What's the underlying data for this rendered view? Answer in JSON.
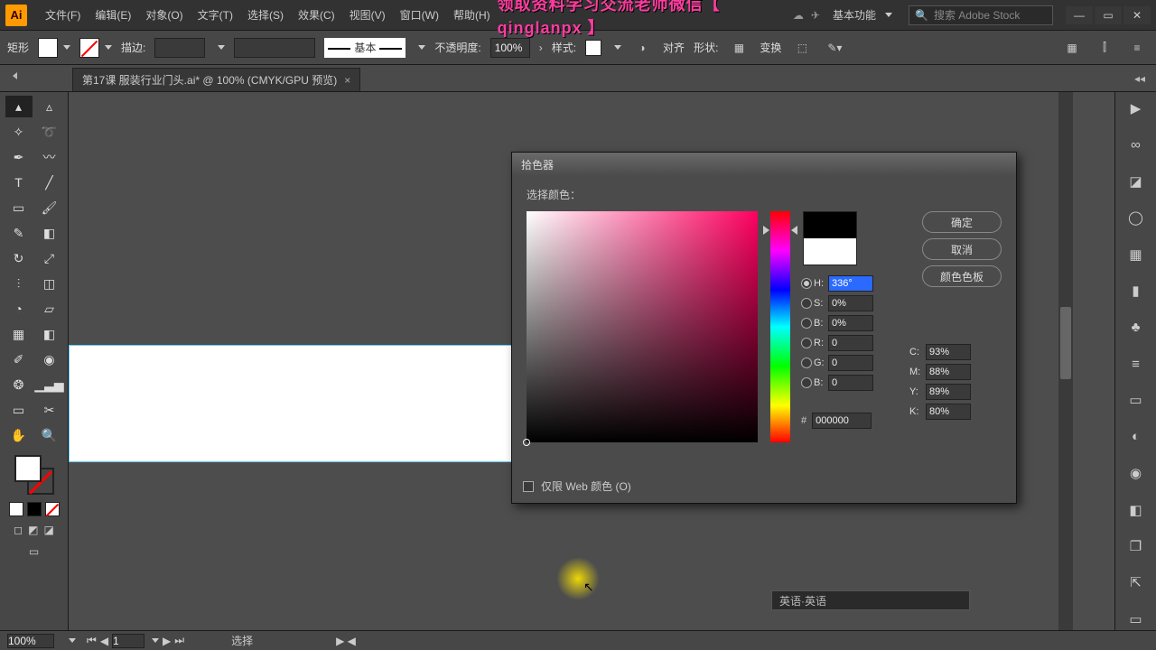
{
  "app": {
    "logo_text": "Ai",
    "watermark_text": "领取资料学习交流老师微信【 qinglanpx 】",
    "workspace_label": "基本功能",
    "search_placeholder": "搜索 Adobe Stock"
  },
  "menu": {
    "file": "文件(F)",
    "edit": "编辑(E)",
    "object": "对象(O)",
    "type": "文字(T)",
    "select": "选择(S)",
    "effect": "效果(C)",
    "view": "视图(V)",
    "window": "窗口(W)",
    "help": "帮助(H)"
  },
  "controlbar": {
    "shape_label": "矩形",
    "stroke_label": "描边:",
    "opacity_label": "不透明度:",
    "opacity_value": "100%",
    "style_label": "样式:",
    "align_label": "对齐",
    "shape_btn": "形状:",
    "transform_label": "变换",
    "preset_label": "基本"
  },
  "doc_tab": {
    "title": "第17课 服装行业门头.ai* @ 100% (CMYK/GPU 预览)"
  },
  "statusbar": {
    "zoom": "100%",
    "page": "1",
    "mode": "选择"
  },
  "ime": {
    "label": "英语·英语"
  },
  "color_picker": {
    "title": "拾色器",
    "choose_label": "选择颜色：",
    "ok": "确定",
    "cancel": "取消",
    "swatches": "颜色色板",
    "web_only": "仅限 Web 颜色 (O)",
    "H_label": "H:",
    "H_value": "336°",
    "S_label": "S:",
    "S_value": "0%",
    "Bri_label": "B:",
    "Bri_value": "0%",
    "R_label": "R:",
    "R_value": "0",
    "G_label": "G:",
    "G_value": "0",
    "B_label": "B:",
    "B_value": "0",
    "C_label": "C:",
    "C_value": "93%",
    "M_label": "M:",
    "M_value": "88%",
    "Y_label": "Y:",
    "Y_value": "89%",
    "K_label": "K:",
    "K_value": "80%",
    "hex_label": "#",
    "hex_value": "000000"
  }
}
